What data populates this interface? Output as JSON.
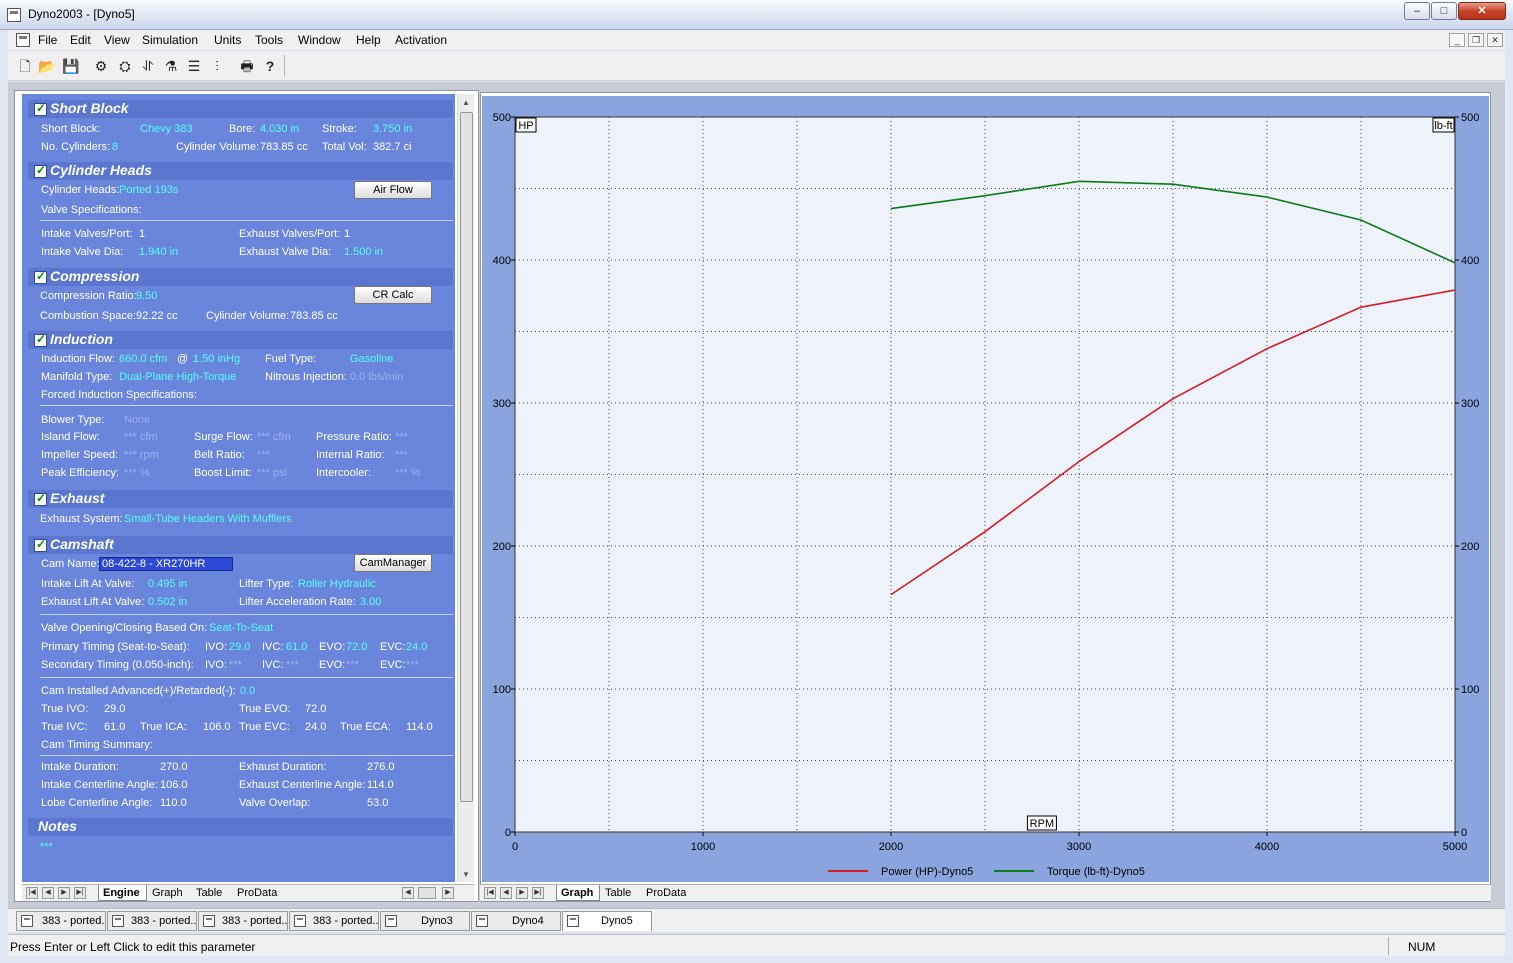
{
  "window": {
    "title": "Dyno2003 - [Dyno5]",
    "min": "–",
    "max": "□",
    "close": "✕"
  },
  "menu": [
    "File",
    "Edit",
    "View",
    "Simulation",
    "Units",
    "Tools",
    "Window",
    "Help",
    "Activation"
  ],
  "mdi_controls": {
    "min": "_",
    "restore": "❐",
    "close": "✕"
  },
  "toolbar_icons": [
    "new-file-icon",
    "open-folder-icon",
    "save-icon",
    "engine-icon",
    "engine-run-icon",
    "dyno-icon",
    "valve-icon",
    "cam-icon",
    "stats-icon",
    "print-icon",
    "help-icon"
  ],
  "toolbar_glyphs": [
    "🗋",
    "📂",
    "💾",
    "⚙",
    "⛭",
    "⥯",
    "⚗",
    "☰",
    "⫶",
    "🖶",
    "?"
  ],
  "short_block": {
    "title": "Short Block",
    "short_block_label": "Short Block:",
    "short_block_value": "Chevy 383",
    "bore_label": "Bore:",
    "bore_value": "4.030 in",
    "stroke_label": "Stroke:",
    "stroke_value": "3.750 in",
    "cylinders_label": "No. Cylinders:",
    "cylinders_value": "8",
    "cyl_volume_label": "Cylinder Volume:",
    "cyl_volume_value": "783.85 cc",
    "total_vol_label": "Total Vol:",
    "total_vol_value": "382.7 ci"
  },
  "cylinder_heads": {
    "title": "Cylinder Heads",
    "heads_label": "Cylinder Heads:",
    "heads_value": "Ported 193s",
    "airflow_button": "Air Flow",
    "valve_specs_label": "Valve Specifications:",
    "intake_valves_label": "Intake Valves/Port:",
    "intake_valves_value": "1",
    "exhaust_valves_label": "Exhaust Valves/Port:",
    "exhaust_valves_value": "1",
    "intake_dia_label": "Intake Valve Dia:",
    "intake_dia_value": "1.940 in",
    "exhaust_dia_label": "Exhaust Valve Dia:",
    "exhaust_dia_value": "1.500 in"
  },
  "compression": {
    "title": "Compression",
    "ratio_label": "Compression Ratio:",
    "ratio_value": "9.50",
    "cr_calc_button": "CR Calc",
    "space_label": "Combustion Space:",
    "space_value": "92.22 cc",
    "cyl_volume_label": "Cylinder Volume:",
    "cyl_volume_value": "783.85 cc"
  },
  "induction": {
    "title": "Induction",
    "flow_label": "Induction Flow:",
    "flow_value": "660.0 cfm",
    "at": "@",
    "flow_pressure": "1.50 inHg",
    "fuel_label": "Fuel Type:",
    "fuel_value": "Gasoline",
    "manifold_label": "Manifold Type:",
    "manifold_value": "Dual-Plane High-Torque",
    "nitrous_label": "Nitrous Injection:",
    "nitrous_value": "0.0 lbs/min",
    "forced_label": "Forced Induction Specifications:",
    "blower_label": "Blower Type:",
    "blower_value": "None",
    "island_label": "Island Flow:",
    "island_value": "*** cfm",
    "surge_label": "Surge Flow:",
    "surge_value": "*** cfm",
    "pressure_label": "Pressure Ratio:",
    "pressure_value": "***",
    "impeller_label": "Impeller Speed:",
    "impeller_value": "*** rpm",
    "belt_label": "Belt Ratio:",
    "belt_value": "***",
    "internal_label": "Internal Ratio:",
    "internal_value": "***",
    "peak_label": "Peak Efficiency:",
    "peak_value": "*** %",
    "boost_label": "Boost Limit:",
    "boost_value": "*** psi",
    "intercooler_label": "Intercooler:",
    "intercooler_value": "*** %"
  },
  "exhaust": {
    "title": "Exhaust",
    "system_label": "Exhaust System:",
    "system_value": "Small-Tube Headers With Mufflers"
  },
  "camshaft": {
    "title": "Camshaft",
    "cam_name_label": "Cam Name:",
    "cam_name_value": "08-422-8 - XR270HR",
    "cam_manager_button": "CamManager",
    "intake_lift_label": "Intake Lift At Valve:",
    "intake_lift_value": "0.495 in",
    "lifter_type_label": "Lifter Type:",
    "lifter_type_value": "Roller Hydraulic",
    "exhaust_lift_label": "Exhaust Lift At Valve:",
    "exhaust_lift_value": "0.502 in",
    "lifter_accel_label": "Lifter Acceleration Rate:",
    "lifter_accel_value": "3.00",
    "based_on_label": "Valve Opening/Closing Based On:",
    "based_on_value": "Seat-To-Seat",
    "primary_label": "Primary Timing (Seat-to-Seat):",
    "ivo_label": "IVO:",
    "primary_ivo": "29.0",
    "ivc_label": "IVC:",
    "primary_ivc": "61.0",
    "evo_label": "EVO:",
    "primary_evo": "72.0",
    "evc_label": "EVC:",
    "primary_evc": "24.0",
    "secondary_label": "Secondary Timing (0.050-inch):",
    "secondary_ivo": "***",
    "secondary_ivc": "***",
    "secondary_evo": "***",
    "secondary_evc": "***",
    "advanced_label": "Cam Installed Advanced(+)/Retarded(-):",
    "advanced_value": "0.0",
    "true_ivo_label": "True IVO:",
    "true_ivo_value": "29.0",
    "true_evo_label": "True EVO:",
    "true_evo_value": "72.0",
    "true_ivc_label": "True IVC:",
    "true_ivc_value": "61.0",
    "true_ica_label": "True ICA:",
    "true_ica_value": "106.0",
    "true_evc_label": "True EVC:",
    "true_evc_value": "24.0",
    "true_eca_label": "True ECA:",
    "true_eca_value": "114.0",
    "summary_label": "Cam Timing Summary:",
    "intake_dur_label": "Intake Duration:",
    "intake_dur_value": "270.0",
    "exhaust_dur_label": "Exhaust Duration:",
    "exhaust_dur_value": "276.0",
    "intake_cl_label": "Intake Centerline Angle:",
    "intake_cl_value": "106.0",
    "exhaust_cl_label": "Exhaust Centerline Angle:",
    "exhaust_cl_value": "114.0",
    "lobe_cl_label": "Lobe Centerline Angle:",
    "lobe_cl_value": "110.0",
    "overlap_label": "Valve Overlap:",
    "overlap_value": "53.0"
  },
  "notes": {
    "title": "Notes",
    "value": "***"
  },
  "left_tabs": [
    "Engine",
    "Graph",
    "Table",
    "ProData"
  ],
  "right_tabs": [
    "Graph",
    "Table",
    "ProData"
  ],
  "doc_tabs": [
    "383 - ported...",
    "383 - ported...",
    "383 - ported...",
    "383 - ported...",
    "Dyno3",
    "Dyno4",
    "Dyno5"
  ],
  "status": {
    "message": "Press Enter or Left Click to edit this parameter",
    "num": "NUM"
  },
  "colors": {
    "power": "#d41c24",
    "torque": "#0f7a1a",
    "panel": "#6a86dc",
    "plot_bg": "#eef2fb"
  },
  "chart_data": {
    "type": "line",
    "xlabel": "RPM",
    "ylabel_left": "HP",
    "ylabel_right": "lb-ft",
    "xlim": [
      0,
      5000
    ],
    "ylim_left": [
      0,
      500
    ],
    "ylim_right": [
      0,
      500
    ],
    "x_ticks": [
      0,
      1000,
      2000,
      3000,
      4000,
      5000
    ],
    "y_ticks": [
      0,
      100,
      200,
      300,
      400,
      500
    ],
    "grid": true,
    "legend_position": "bottom",
    "series": [
      {
        "name": "Power (HP)-Dyno5",
        "axis": "left",
        "x": [
          2000,
          2500,
          3000,
          3500,
          4000,
          4500,
          5000
        ],
        "values": [
          166,
          210,
          259,
          303,
          338,
          367,
          379
        ]
      },
      {
        "name": "Torque (lb-ft)-Dyno5",
        "axis": "right",
        "x": [
          2000,
          2500,
          3000,
          3500,
          4000,
          4500,
          5000
        ],
        "values": [
          436,
          445,
          455,
          453,
          444,
          428,
          398
        ]
      }
    ]
  }
}
